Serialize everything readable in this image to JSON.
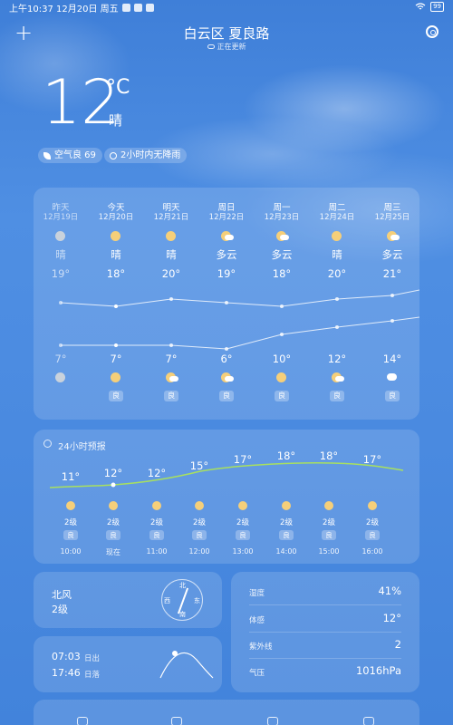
{
  "status_bar": {
    "time_date": "上午10:37 12月20日 周五",
    "battery": "99"
  },
  "header": {
    "location": "白云区 夏良路",
    "updating": "正在更新"
  },
  "current": {
    "temp": "12",
    "unit": "°C",
    "condition": "晴",
    "air_quality": "空气良 69",
    "rain_forecast": "2小时内无降雨"
  },
  "daily": [
    {
      "day": "昨天",
      "date": "12月19日",
      "cond": "晴",
      "high": "19°",
      "low": "7°",
      "aqi": "",
      "icon": "sun-icon"
    },
    {
      "day": "今天",
      "date": "12月20日",
      "cond": "晴",
      "high": "18°",
      "low": "7°",
      "aqi": "良",
      "icon": "sun-icon"
    },
    {
      "day": "明天",
      "date": "12月21日",
      "cond": "晴",
      "high": "20°",
      "low": "7°",
      "aqi": "良",
      "icon": "sun-icon"
    },
    {
      "day": "周日",
      "date": "12月22日",
      "cond": "多云",
      "high": "19°",
      "low": "6°",
      "aqi": "良",
      "icon": "partly-cloudy-icon"
    },
    {
      "day": "周一",
      "date": "12月23日",
      "cond": "多云",
      "high": "18°",
      "low": "10°",
      "aqi": "良",
      "icon": "partly-cloudy-icon"
    },
    {
      "day": "周二",
      "date": "12月24日",
      "cond": "晴",
      "high": "20°",
      "low": "12°",
      "aqi": "良",
      "icon": "sun-icon"
    },
    {
      "day": "周三",
      "date": "12月25日",
      "cond": "多云",
      "high": "21°",
      "low": "14°",
      "aqi": "良",
      "icon": "partly-cloudy-icon"
    }
  ],
  "hourly": {
    "title": "24小时预报",
    "items": [
      {
        "temp": "11°",
        "wind": "2级",
        "aqi": "良",
        "time": "10:00"
      },
      {
        "temp": "12°",
        "wind": "2级",
        "aqi": "良",
        "time": "现在"
      },
      {
        "temp": "12°",
        "wind": "2级",
        "aqi": "良",
        "time": "11:00"
      },
      {
        "temp": "15°",
        "wind": "2级",
        "aqi": "良",
        "time": "12:00"
      },
      {
        "temp": "17°",
        "wind": "2级",
        "aqi": "良",
        "time": "13:00"
      },
      {
        "temp": "18°",
        "wind": "2级",
        "aqi": "良",
        "time": "14:00"
      },
      {
        "temp": "18°",
        "wind": "2级",
        "aqi": "良",
        "time": "15:00"
      },
      {
        "temp": "17°",
        "wind": "2级",
        "aqi": "良",
        "time": "16:00"
      }
    ]
  },
  "wind": {
    "direction": "北风",
    "level": "2级",
    "compass": {
      "n": "北",
      "e": "东",
      "s": "南",
      "w": "西"
    }
  },
  "sun": {
    "sunrise": "07:03",
    "sunrise_label": "日出",
    "sunset": "17:46",
    "sunset_label": "日落"
  },
  "details": [
    {
      "label": "湿度",
      "value": "41%"
    },
    {
      "label": "体感",
      "value": "12°"
    },
    {
      "label": "紫外线",
      "value": "2"
    },
    {
      "label": "气压",
      "value": "1016hPa"
    }
  ],
  "colors": {
    "sky_top": "#3f7fd8",
    "sky_bottom": "#4283db",
    "sun": "#f5cf7a",
    "hourly_line": "#a8e05f"
  }
}
